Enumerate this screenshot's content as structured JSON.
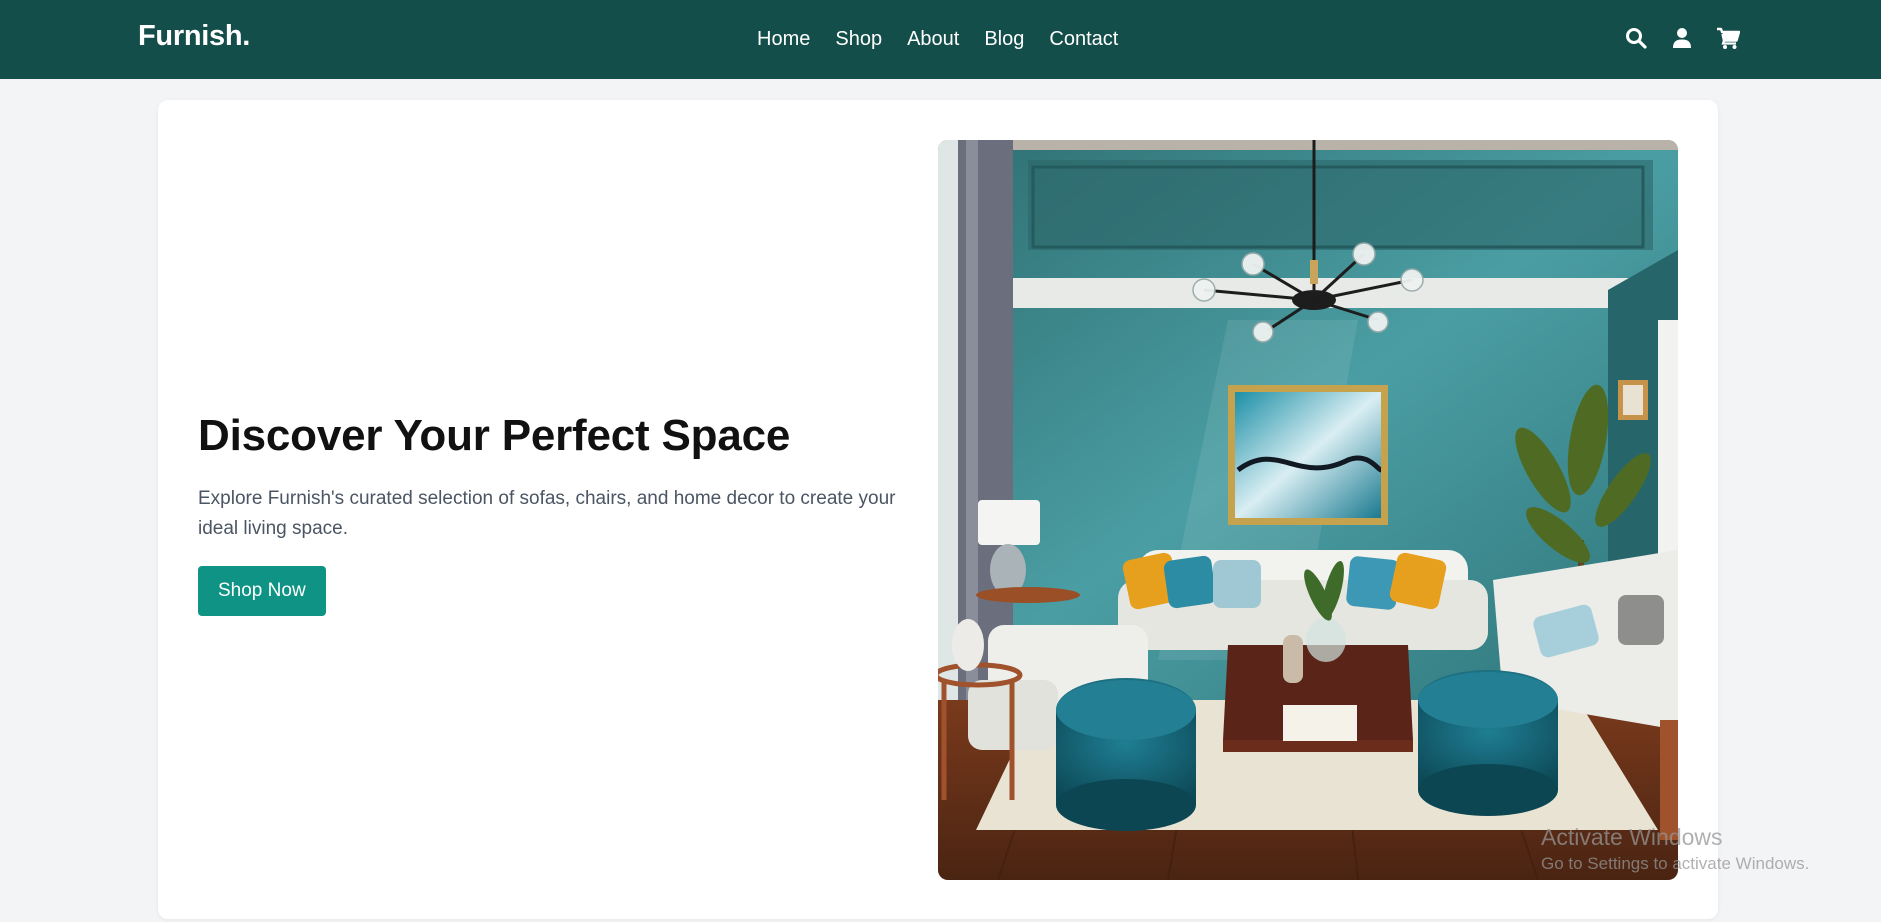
{
  "brand": {
    "logo_text": "Furnish."
  },
  "nav": {
    "links": [
      {
        "label": "Home"
      },
      {
        "label": "Shop"
      },
      {
        "label": "About"
      },
      {
        "label": "Blog"
      },
      {
        "label": "Contact"
      }
    ],
    "icons": [
      "search-icon",
      "user-icon",
      "cart-icon"
    ]
  },
  "hero": {
    "title": "Discover Your Perfect Space",
    "description": "Explore Furnish's curated selection of sofas, chairs, and home decor to create your ideal living space.",
    "cta_label": "Shop Now",
    "image_alt": "Living room with teal walls, white sofas and teal ottomans"
  },
  "watermark": {
    "title": "Activate Windows",
    "subtitle": "Go to Settings to activate Windows."
  },
  "colors": {
    "navbar": "#134e4a",
    "accent": "#0f9384",
    "page_bg": "#f3f4f6"
  }
}
